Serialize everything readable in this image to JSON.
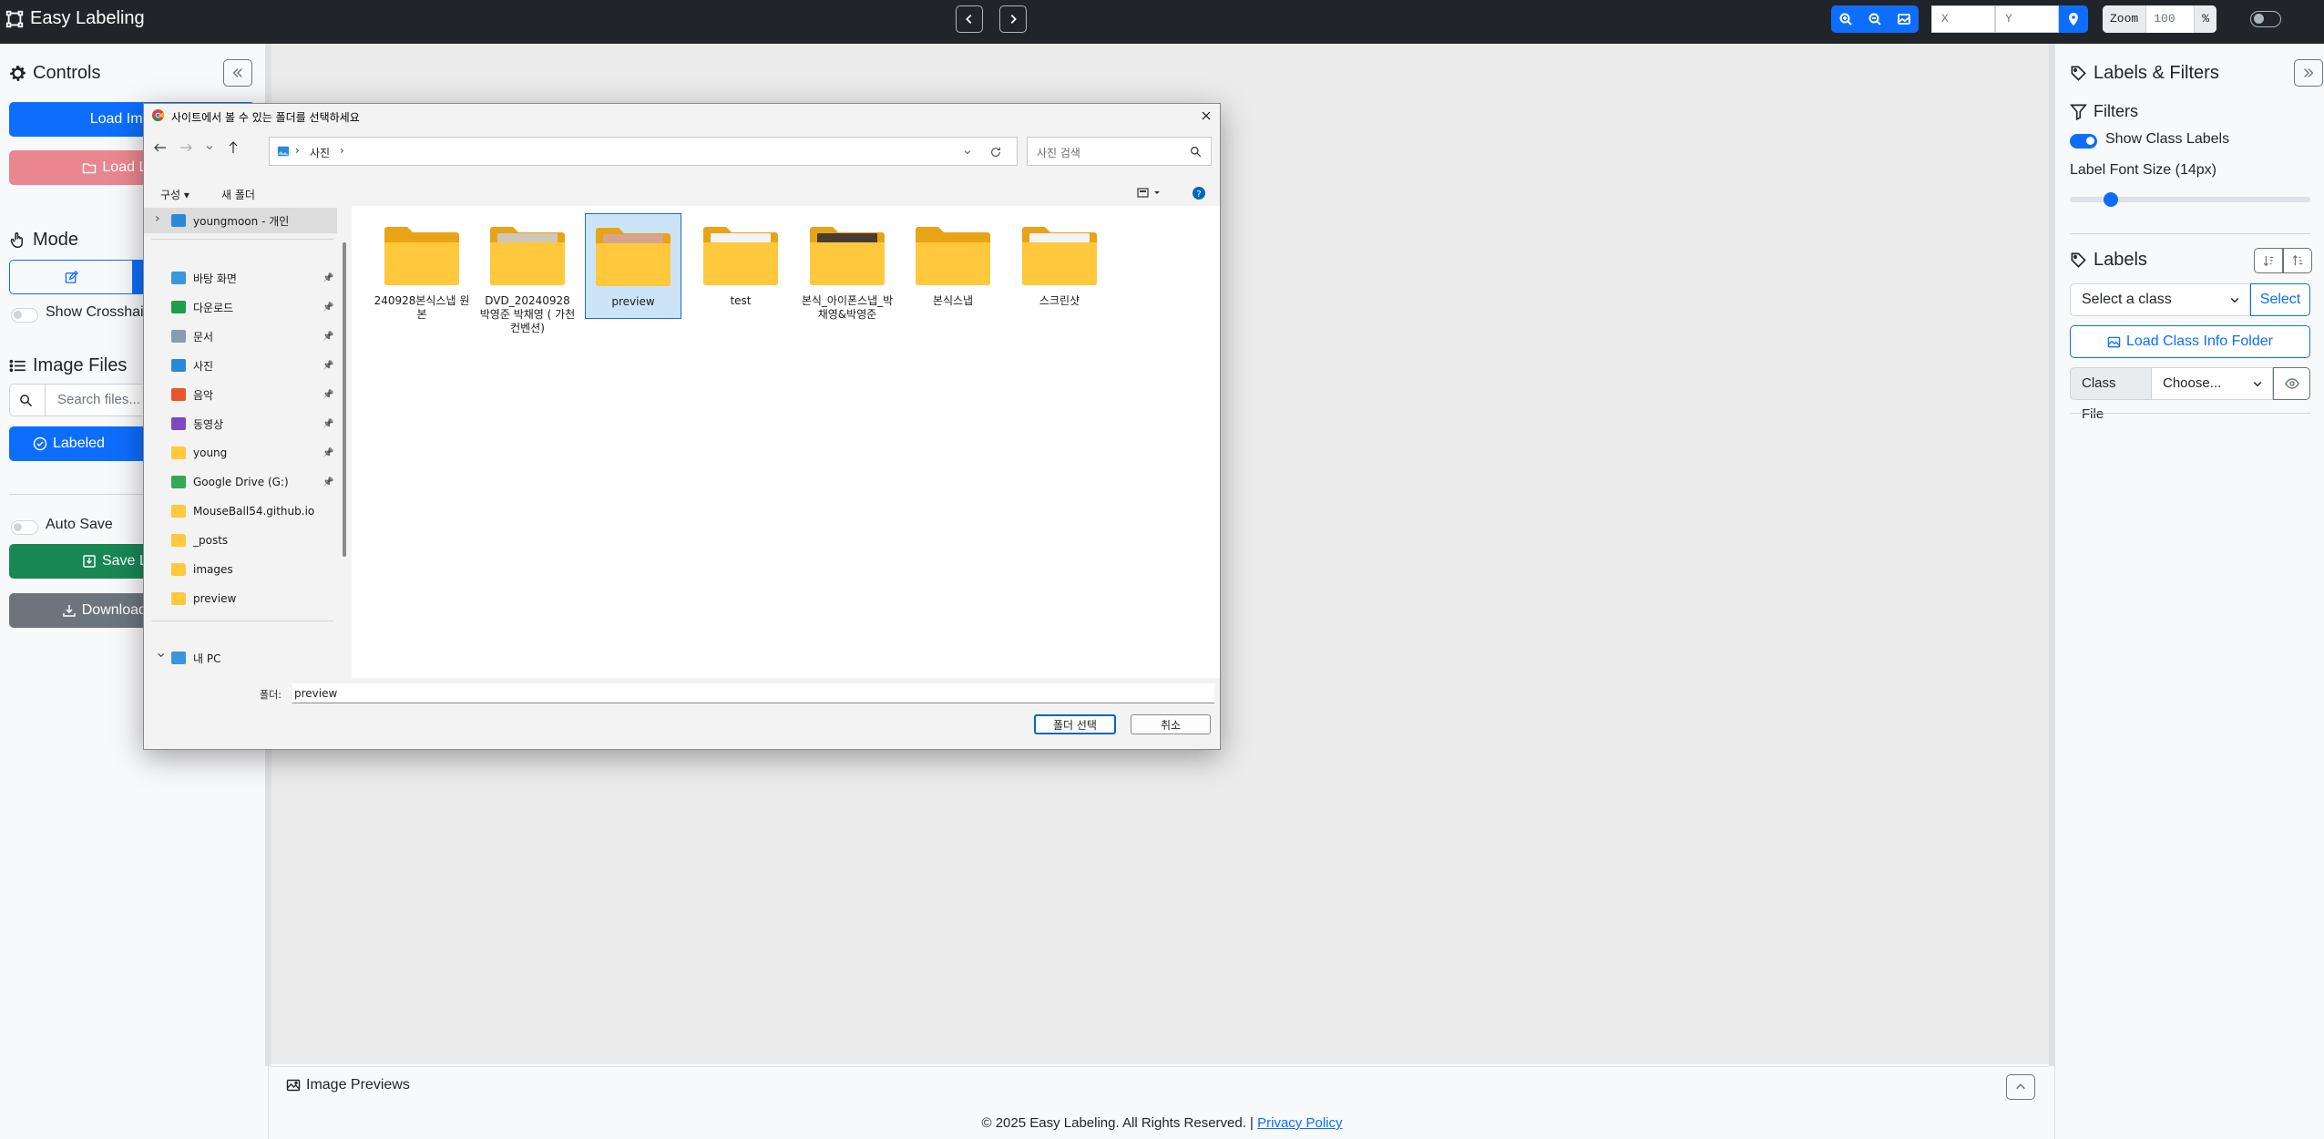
{
  "app": {
    "title": "Easy Labeling"
  },
  "toolbar": {
    "x_placeholder": "X",
    "y_placeholder": "Y",
    "zoom_label": "Zoom",
    "zoom_value": "100",
    "zoom_unit": "%"
  },
  "left": {
    "controls_title": "Controls",
    "load_images": "Load Images",
    "load_labels": "Load Labels",
    "mode_title": "Mode",
    "show_crosshair": "Show Crosshair",
    "image_files_title": "Image Files",
    "search_placeholder": "Search files...",
    "labeled_tab": "Labeled",
    "auto_save": "Auto Save",
    "save_labels": "Save Labels",
    "download_classes": "Download Classes"
  },
  "right": {
    "title": "Labels & Filters",
    "filters_title": "Filters",
    "show_class_labels": "Show Class Labels",
    "font_size_label": "Label Font Size (14px)",
    "font_size_fraction": 0.17,
    "labels_title": "Labels",
    "select_class_placeholder": "Select a class",
    "select_button": "Select",
    "load_class_info": "Load Class Info Folder",
    "class_file_label": "Class File",
    "class_file_value": "Choose..."
  },
  "canvas": {
    "previews_title": "Image Previews"
  },
  "footer": {
    "text": "© 2025 Easy Labeling. All Rights Reserved. | ",
    "link": "Privacy Policy"
  },
  "dialog": {
    "title": "사이트에서 볼 수 있는 폴더를 선택하세요",
    "address_root": "사진",
    "search_placeholder": "사진 검색",
    "organize": "구성",
    "new_folder": "새 폴더",
    "nav": [
      {
        "label": "youngmoon - 개인",
        "icon": "cloud-icon"
      },
      {
        "label": "바탕 화면",
        "icon": "desktop-icon"
      },
      {
        "label": "다운로드",
        "icon": "download-icon"
      },
      {
        "label": "문서",
        "icon": "document-icon"
      },
      {
        "label": "사진",
        "icon": "pictures-icon"
      },
      {
        "label": "음악",
        "icon": "music-icon"
      },
      {
        "label": "동영상",
        "icon": "video-icon"
      },
      {
        "label": "young",
        "icon": "folder-icon"
      },
      {
        "label": "Google Drive (G:)",
        "icon": "drive-icon"
      },
      {
        "label": "MouseBall54.github.io",
        "icon": "folder-icon"
      },
      {
        "label": "_posts",
        "icon": "folder-icon"
      },
      {
        "label": "images",
        "icon": "folder-icon"
      },
      {
        "label": "preview",
        "icon": "folder-icon"
      },
      {
        "label": "내 PC",
        "icon": "pc-icon"
      }
    ],
    "folders": [
      {
        "name": "240928본식스냅 원본"
      },
      {
        "name": "DVD_20240928 박영준 박채영 ( 가천컨벤션)"
      },
      {
        "name": "preview"
      },
      {
        "name": "test"
      },
      {
        "name": "본식_아이폰스냅_박채영&박영준"
      },
      {
        "name": "본식스냅"
      },
      {
        "name": "스크린샷"
      }
    ],
    "folder_label": "폴더:",
    "folder_value": "preview",
    "select_button": "폴더 선택",
    "cancel_button": "취소"
  },
  "colors": {
    "primary": "#0d6efd",
    "danger": "#ea868f",
    "success": "#198754",
    "secondary": "#6c757d",
    "navbar": "#212529",
    "folder": "#ffc83d"
  }
}
